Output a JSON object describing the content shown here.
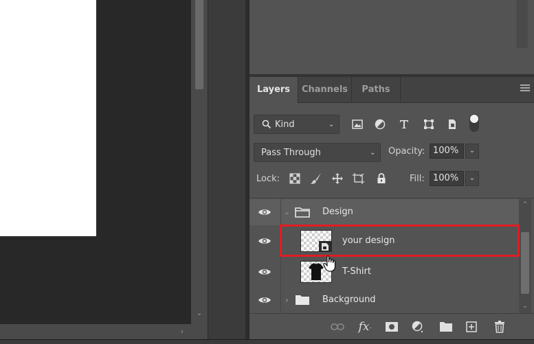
{
  "tabs": [
    {
      "label": "Layers",
      "active": true
    },
    {
      "label": "Channels",
      "active": false
    },
    {
      "label": "Paths",
      "active": false
    }
  ],
  "filter": {
    "kind_label": "Kind",
    "icons": [
      "image-filter-icon",
      "adjustment-filter-icon",
      "type-filter-icon",
      "shape-filter-icon",
      "smart-object-filter-icon"
    ]
  },
  "blend": {
    "mode": "Pass Through",
    "opacity_label": "Opacity:",
    "opacity_value": "100%"
  },
  "lock": {
    "label": "Lock:",
    "fill_label": "Fill:",
    "fill_value": "100%",
    "icons": [
      "lock-transparent-pixels-icon",
      "lock-image-pixels-icon",
      "lock-position-icon",
      "lock-artboard-icon",
      "lock-all-icon"
    ]
  },
  "layers": [
    {
      "name": "Design",
      "type": "group",
      "expanded": true,
      "visible": true,
      "selected": true
    },
    {
      "name": "your design",
      "type": "smart-object",
      "visible": true,
      "highlighted": true
    },
    {
      "name": "T-Shirt",
      "type": "layer",
      "visible": true
    },
    {
      "name": "Background",
      "type": "group",
      "expanded": false,
      "visible": true
    }
  ],
  "bottom_toolbar": [
    "link-layers-icon",
    "fx-icon",
    "mask-icon",
    "adjustment-layer-icon",
    "new-group-icon",
    "new-layer-icon",
    "delete-icon"
  ],
  "colors": {
    "highlight": "#e31b23",
    "panel": "#535353",
    "selected_row": "#5f5f5f"
  }
}
